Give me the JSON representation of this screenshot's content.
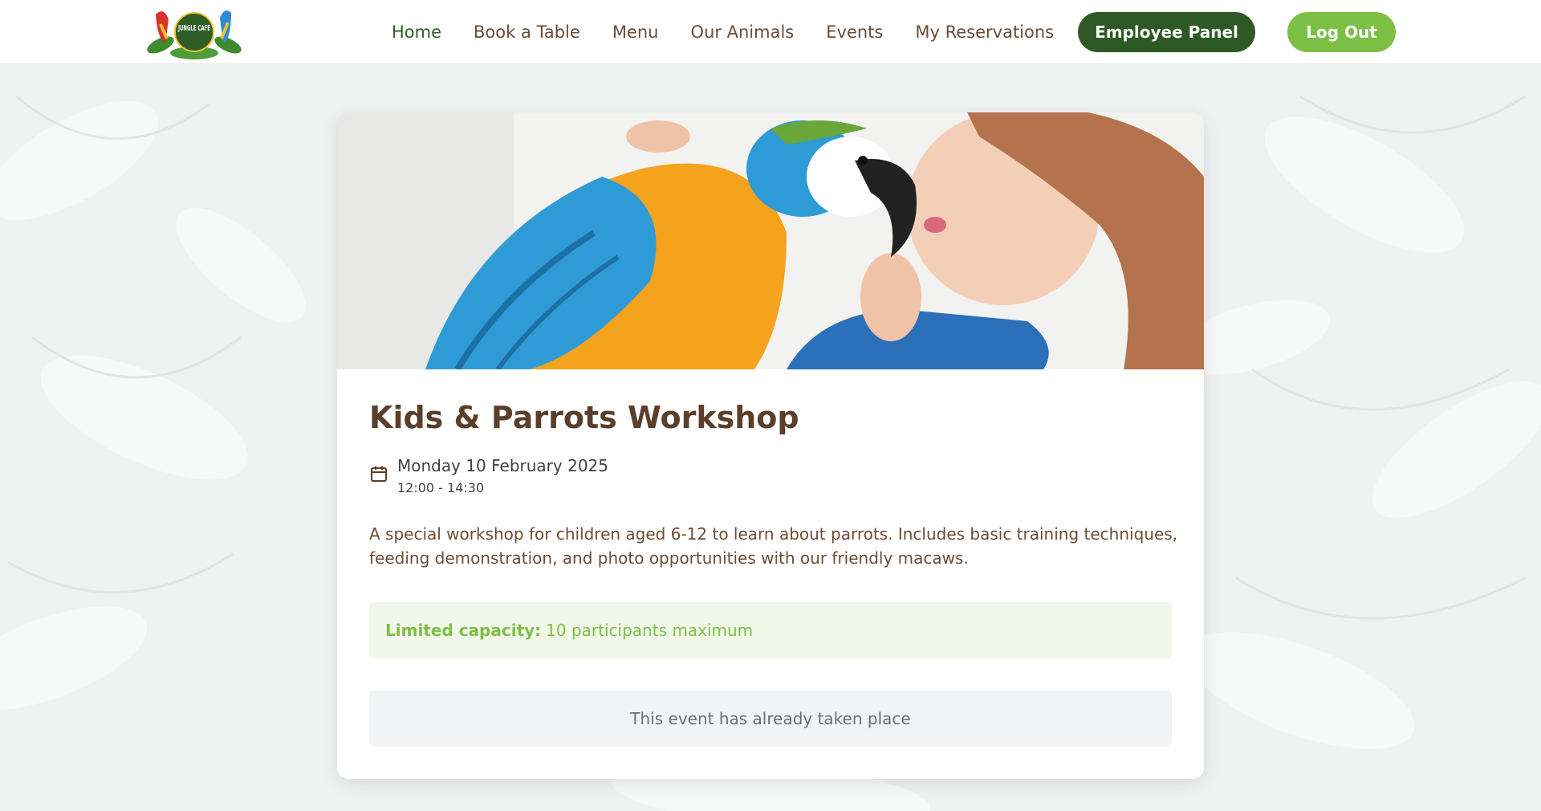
{
  "header": {
    "logo_text": "JUNGLE CAFE",
    "nav": [
      "Home",
      "Book a Table",
      "Menu",
      "Our Animals",
      "Events",
      "My Reservations"
    ],
    "employee_button": "Employee Panel",
    "logout_button": "Log Out"
  },
  "event": {
    "title": "Kids & Parrots Workshop",
    "date": "Monday 10 February 2025",
    "time": "12:00 - 14:30",
    "description": "A special workshop for children aged 6-12 to learn about parrots. Includes basic training techniques, feeding demonstration, and photo opportunities with our friendly macaws.",
    "capacity_label": "Limited capacity:",
    "capacity_value": "10 participants maximum",
    "status": "This event has already taken place"
  },
  "colors": {
    "brand_dark_green": "#2d5a24",
    "brand_light_green": "#7cbf45",
    "brown_text": "#5b3f2a"
  }
}
